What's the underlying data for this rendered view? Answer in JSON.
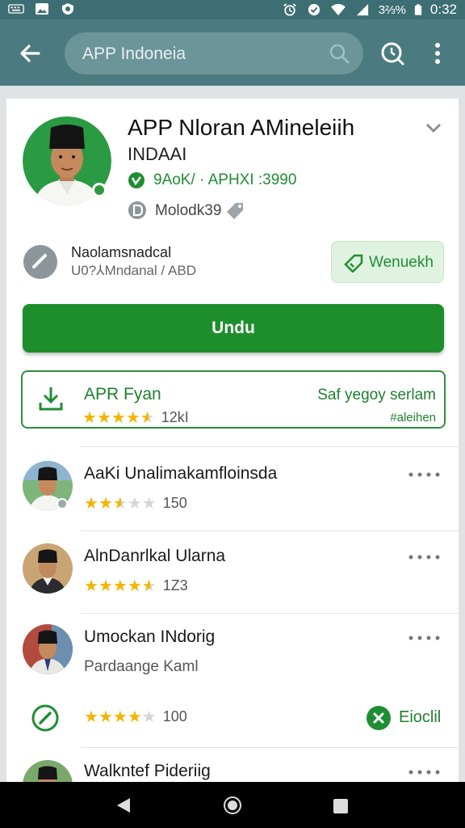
{
  "status_bar": {
    "time": "0:32",
    "battery": "3⅔%",
    "icons": [
      "keyboard-icon",
      "image-icon",
      "shield-icon",
      "alarm-icon",
      "data-saver-icon",
      "wifi-icon",
      "signal-icon",
      "battery-icon"
    ]
  },
  "app_bar": {
    "search_text": "APP Indoneia",
    "icons": [
      "back-arrow-icon",
      "search-icon",
      "clock-icon",
      "more-vert-icon"
    ]
  },
  "app": {
    "title": "APP Nloran AMineleiih",
    "subtitle": "INDAAI",
    "verified_text": "9AoK/ · APHXI :3990",
    "developer": "Molodk39",
    "info_line1": "Naolamsnadcal",
    "info_line2": "U0?⅄Mndanal / ABD",
    "wishlist_label": "Wenuekh",
    "install_label": "Undu"
  },
  "featured": {
    "title": "APR Fyan",
    "rating": 4.5,
    "count": "12kI",
    "right_line1": "Saf yegoy serlam",
    "right_line2": "#aleihen"
  },
  "list": [
    {
      "name": "AaKi Unalimakamfloinsda",
      "rating": 2.5,
      "count": "150",
      "sub": ""
    },
    {
      "name": "AlnDanrlkal Ularna",
      "rating": 4.5,
      "count": "1Z3",
      "sub": ""
    },
    {
      "name": "Umockan INdorig",
      "rating": 4,
      "count": "100",
      "sub": "Pardaange Kaml",
      "report_label": "Eioclil"
    },
    {
      "name": "Walkntef Pideriig",
      "rating": 0,
      "count": "",
      "sub": ""
    }
  ],
  "colors": {
    "status_bar": "#3d6e74",
    "app_bar": "#4b7b80",
    "accent_green": "#1e8e2d",
    "star": "#f4b400"
  }
}
